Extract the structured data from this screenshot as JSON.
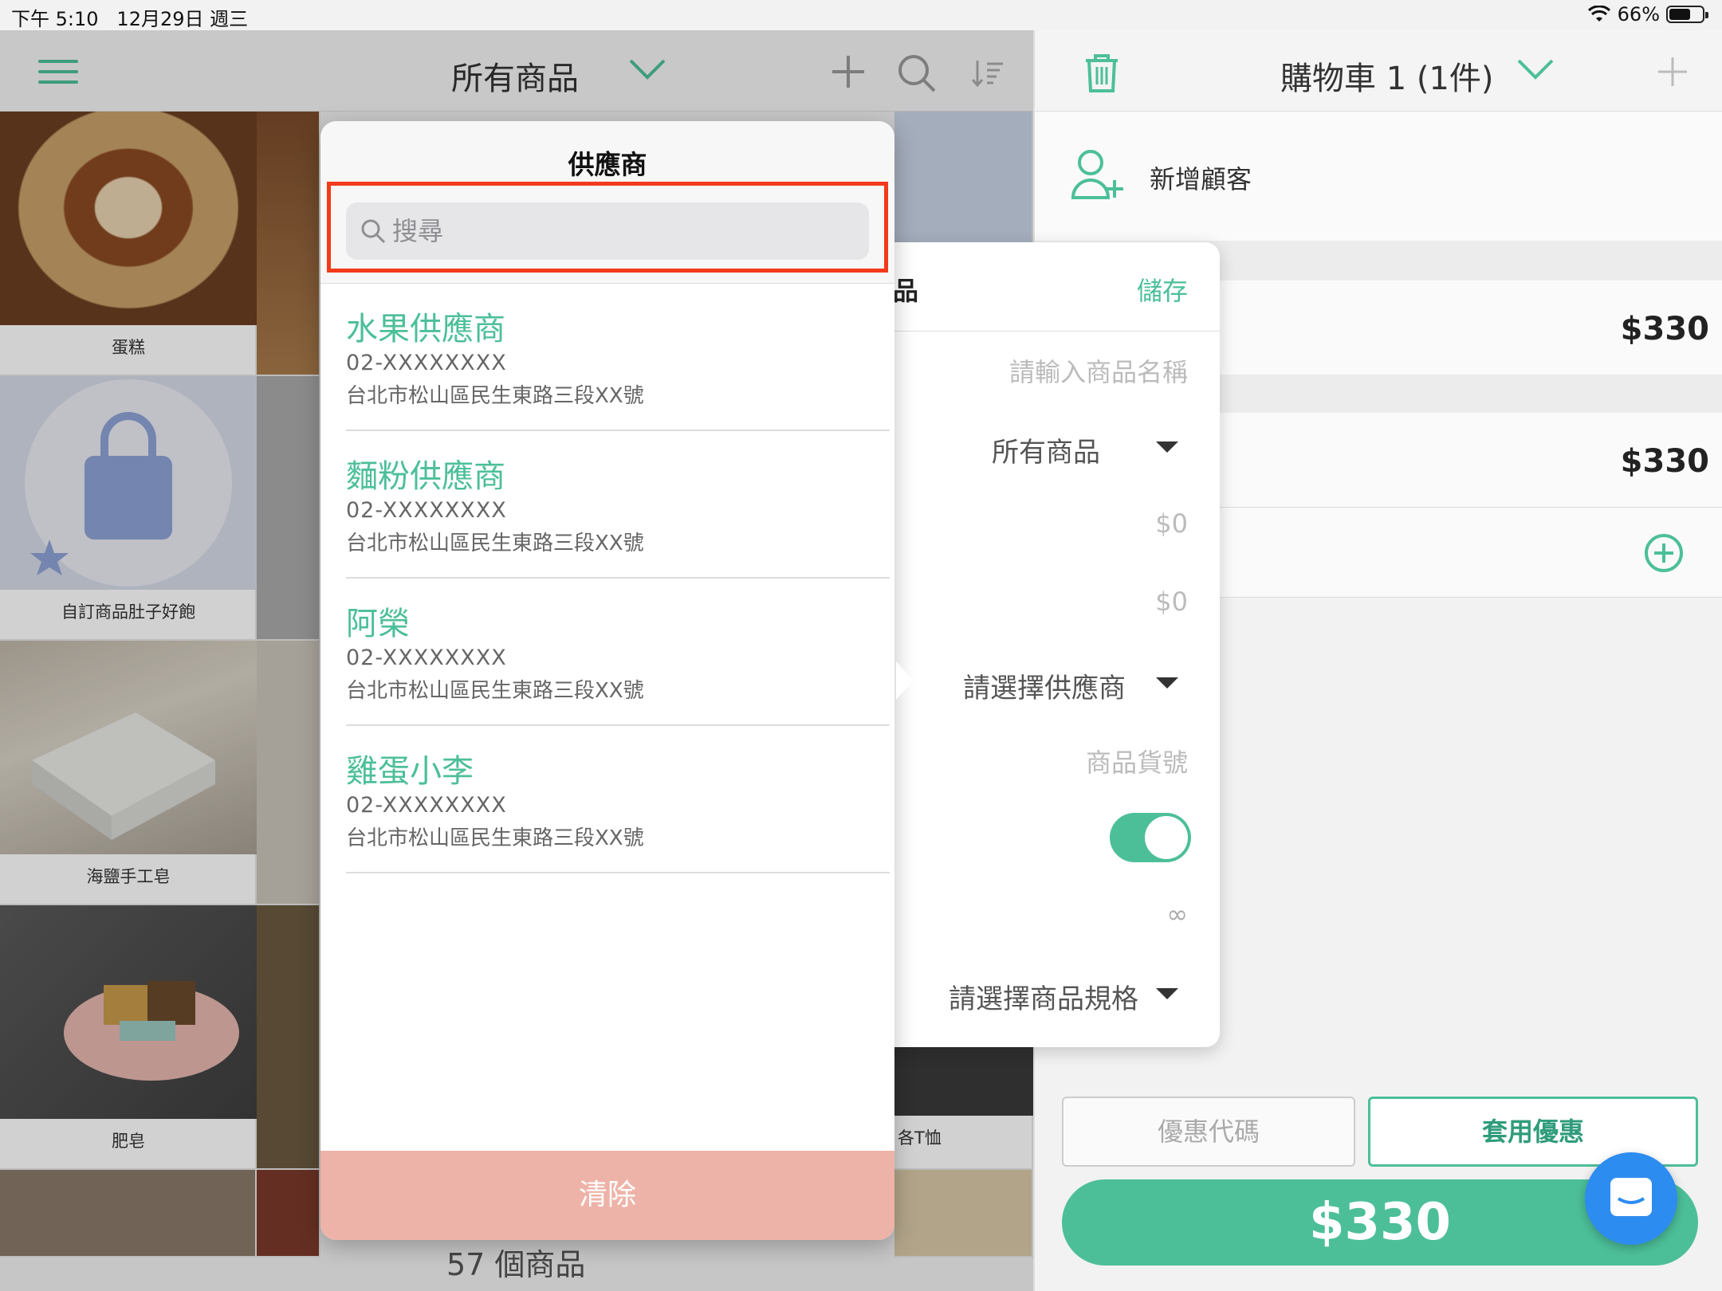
{
  "status": {
    "time": "下午 5:10",
    "date": "12月29日 週三",
    "battery": "66%",
    "battery_fraction": 0.66
  },
  "products": {
    "title": "所有商品",
    "count_label": "57 個商品",
    "tiles": [
      {
        "label": "蛋糕"
      },
      {
        "label": "自訂商品肚子好飽"
      },
      {
        "label": "海鹽手工皂"
      },
      {
        "label": "肥皂"
      }
    ],
    "partial_tile_label": "各T恤"
  },
  "cart": {
    "title": "購物車 1 (1件)",
    "add_customer": "新增顧客",
    "line_price_1": "$330",
    "line_price_2": "$330",
    "coupon_placeholder": "優惠代碼",
    "apply_coupon": "套用優惠",
    "checkout_total": "$330"
  },
  "editor": {
    "title_partial": "品",
    "save": "儲存",
    "name_placeholder": "請輸入商品名稱",
    "category": "所有商品",
    "price": "$0",
    "cost": "$0",
    "supplier": "請選擇供應商",
    "sku_placeholder": "商品貨號",
    "toggle_on": true,
    "stock": "∞",
    "variant": "請選擇商品規格"
  },
  "supplier_popover": {
    "title": "供應商",
    "search_placeholder": "搜尋",
    "suppliers": [
      {
        "name": "水果供應商",
        "phone": "02-XXXXXXXX",
        "address": "台北市松山區民生東路三段XX號"
      },
      {
        "name": "麵粉供應商",
        "phone": "02-XXXXXXXX",
        "address": "台北市松山區民生東路三段XX號"
      },
      {
        "name": "阿榮",
        "phone": "02-XXXXXXXX",
        "address": "台北市松山區民生東路三段XX號"
      },
      {
        "name": "雞蛋小李",
        "phone": "02-XXXXXXXX",
        "address": "台北市松山區民生東路三段XX號"
      }
    ],
    "clear": "清除"
  },
  "colors": {
    "accent": "#4cbf99",
    "highlight": "#f23a1c",
    "clear": "#eeb3a8",
    "chat": "#2d8cf0"
  }
}
